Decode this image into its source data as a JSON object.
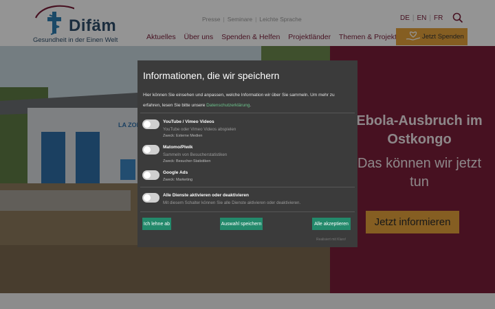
{
  "header": {
    "logo": {
      "name": "Difäm",
      "tagline": "Gesundheit in der Einen Welt"
    },
    "service_nav": [
      "Presse",
      "Seminare",
      "Leichte Sprache"
    ],
    "languages": [
      "DE",
      "EN",
      "FR"
    ],
    "search_icon": "search-icon",
    "main_nav": [
      "Aktuelles",
      "Über uns",
      "Spenden & Helfen",
      "Projektländer",
      "Themen & Projekte"
    ],
    "donate": {
      "label": "Jetzt  Spenden",
      "icon": "heart-hand-icon"
    }
  },
  "hero": {
    "title": "Ebola-Ausbruch im Ostkongo",
    "subtitle": "Das können wir jetzt tun",
    "cta": "Jetzt informieren",
    "image_sign": "LA ZONE"
  },
  "consent": {
    "title": "Informationen, die wir speichern",
    "description_pre": "Hier können Sie einsehen und anpassen, welche Information wir über Sie sammeln. Um mehr zu erfahren, lesen Sie bitte unsere ",
    "description_link": "Datenschutzerklärung",
    "description_post": ".",
    "services": [
      {
        "name": "YouTube / Vimeo Videos",
        "description": "YouTube oder Vimeo Videos abspielen",
        "purpose": "Zweck: Externe Medien"
      },
      {
        "name": "Matomo/Piwik",
        "description": "Sammeln von Besucherstatistiken",
        "purpose": "Zweck: Besucher-Statistiken"
      },
      {
        "name": "Google Ads",
        "description": "",
        "purpose": "Zweck: Marketing"
      }
    ],
    "toggle_all": {
      "name": "Alle Dienste aktivieren oder deaktivieren",
      "description": "Mit diesem Schalter können Sie alle Dienste aktivieren oder deaktivieren."
    },
    "buttons": {
      "decline": "Ich lehne ab",
      "save": "Auswahl speichern",
      "accept_all": "Alle akzeptieren"
    },
    "powered_by": "Realisiert mit Klaro!"
  },
  "colors": {
    "brand": "#7a1e3a",
    "accent": "#e6a33c",
    "consent_button": "#23896b",
    "modal_bg": "#3b3b3b"
  }
}
